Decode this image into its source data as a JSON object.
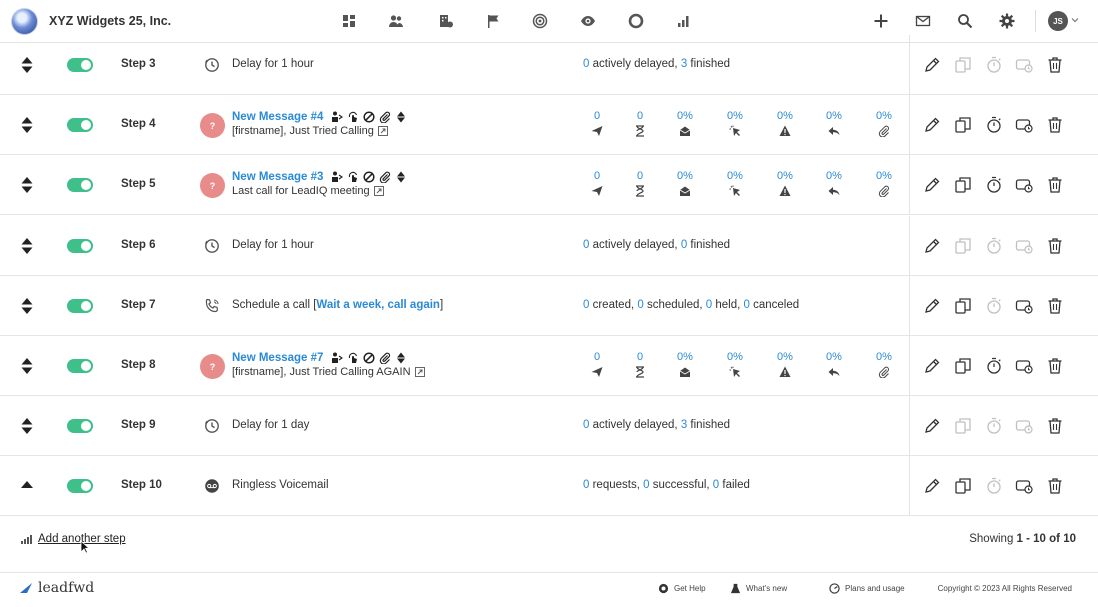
{
  "header": {
    "company": "XYZ Widgets 25, Inc.",
    "nav_icons": [
      "dashboard-icon",
      "contacts-icon",
      "companies-icon",
      "flag-icon",
      "target-icon",
      "eye-icon",
      "circle-icon",
      "bar-chart-icon"
    ],
    "right_icons": [
      "plus-icon",
      "mail-icon",
      "search-icon",
      "gear-icon"
    ],
    "user_initials": "JS"
  },
  "steps": [
    {
      "label": "Step 3",
      "type": "delay",
      "desc_prefix": "Delay for ",
      "desc_strong": "1",
      "desc_suffix": " hour",
      "stats": {
        "a": "0",
        "a_label": " actively delayed, ",
        "b": "3",
        "b_label": " finished"
      }
    },
    {
      "label": "Step 4",
      "type": "message",
      "title": "New Message #4",
      "subtitle": "[firstname], Just Tried Calling",
      "metrics": [
        "0",
        "0",
        "0%",
        "0%",
        "0%",
        "0%",
        "0%"
      ]
    },
    {
      "label": "Step 5",
      "type": "message",
      "title": "New Message #3",
      "subtitle": "Last call for LeadIQ meeting",
      "metrics": [
        "0",
        "0",
        "0%",
        "0%",
        "0%",
        "0%",
        "0%"
      ]
    },
    {
      "label": "Step 6",
      "type": "delay",
      "desc_prefix": "Delay for ",
      "desc_strong": "1",
      "desc_suffix": " hour",
      "stats": {
        "a": "0",
        "a_label": " actively delayed, ",
        "b": "0",
        "b_label": " finished"
      }
    },
    {
      "label": "Step 7",
      "type": "call",
      "desc_prefix": "Schedule a call [",
      "desc_link": "Wait a week, call again",
      "desc_suffix": "]",
      "stats": {
        "a": "0",
        "a_label": " created, ",
        "b": "0",
        "b_label": " scheduled, ",
        "c": "0",
        "c_label": " held, ",
        "d": "0",
        "d_label": " canceled"
      }
    },
    {
      "label": "Step 8",
      "type": "message",
      "title": "New Message #7",
      "subtitle": "[firstname], Just Tried Calling AGAIN",
      "metrics": [
        "0",
        "0",
        "0%",
        "0%",
        "0%",
        "0%",
        "0%"
      ]
    },
    {
      "label": "Step 9",
      "type": "delay",
      "desc_prefix": "Delay for ",
      "desc_strong": "1",
      "desc_suffix": " day",
      "stats": {
        "a": "0",
        "a_label": " actively delayed, ",
        "b": "3",
        "b_label": " finished"
      }
    },
    {
      "label": "Step 10",
      "type": "voicemail",
      "desc_prefix": "Ringless Voicemail",
      "stats": {
        "a": "0",
        "a_label": " requests, ",
        "b": "0",
        "b_label": " successful, ",
        "c": "0",
        "c_label": " failed"
      }
    }
  ],
  "metric_icons": [
    "sent-icon",
    "pending-icon",
    "opened-icon",
    "clicked-icon",
    "bounced-icon",
    "replied-icon",
    "attachment-icon"
  ],
  "footer": {
    "add_step": "Add another step",
    "showing_prefix": "Showing ",
    "showing_range": "1 - 10 of 10",
    "brand": "leadfwd",
    "get_help": "Get Help",
    "whats_new": "What's new",
    "plans": "Plans and usage",
    "copyright": "Copyright © 2023 All Rights Reserved"
  },
  "colors": {
    "accent": "#2b8ad6",
    "toggle_on": "#3fbf8a",
    "avatar": "#e88b8b"
  }
}
